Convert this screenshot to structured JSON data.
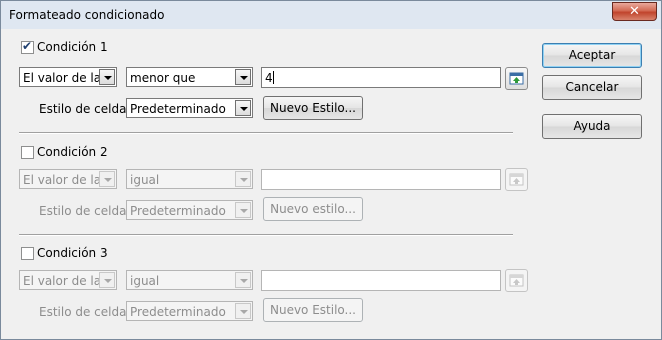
{
  "window": {
    "title": "Formateado condicionado",
    "close_label": "✕"
  },
  "conditions": [
    {
      "label": "Condición 1",
      "checked": true,
      "operand": "El valor de la c",
      "operator": "menor que",
      "value": "4",
      "style_label": "Estilo de celda",
      "style": "Predeterminado",
      "new_style_label": "Nuevo Estilo..."
    },
    {
      "label": "Condición 2",
      "checked": false,
      "operand": "El valor de la c",
      "operator": "igual",
      "value": "",
      "style_label": "Estilo de celda",
      "style": "Predeterminado",
      "new_style_label": "Nuevo estilo..."
    },
    {
      "label": "Condición 3",
      "checked": false,
      "operand": "El valor de la c",
      "operator": "igual",
      "value": "",
      "style_label": "Estilo de celda",
      "style": "Predeterminado",
      "new_style_label": "Nuevo Estilo..."
    }
  ],
  "buttons": {
    "ok": "Aceptar",
    "cancel": "Cancelar",
    "help": "Ayuda"
  },
  "icons": {
    "pick": "shrink-range-icon",
    "close": "close-icon",
    "check": "checkmark-icon"
  },
  "colors": {
    "title_bg": "#dfe7f1",
    "close_red": "#c0442c",
    "default_button_border": "#3c7fb1"
  }
}
